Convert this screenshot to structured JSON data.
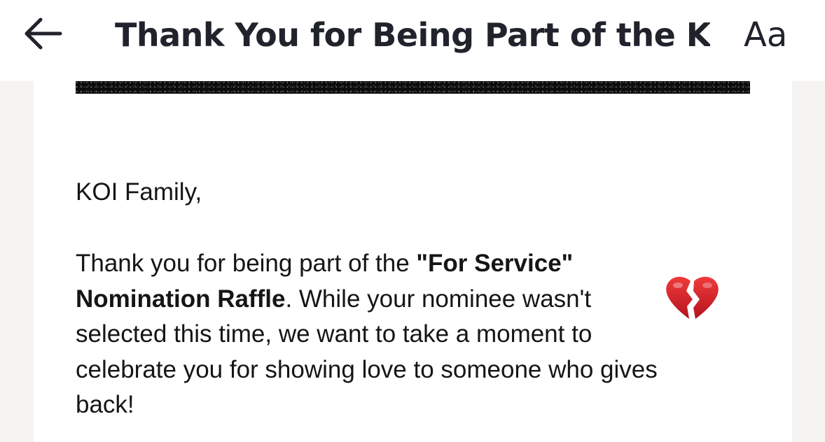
{
  "header": {
    "back_icon": "arrow-left-icon",
    "title": "Thank You for Being Part of the K...",
    "font_size_label": "Aa"
  },
  "email": {
    "banner_image": "dark-textured-banner",
    "greeting": "KOI Family,",
    "body": {
      "line1_text": "Thank you for being part of the ",
      "line1_bold": "\"For Service\"",
      "line2_bold": "Nomination Raffle",
      "line2_text": ". While your nominee wasn't",
      "emoji": "broken-heart-icon",
      "line3": "selected this time, we want to take a moment to",
      "line4": "celebrate you for showing love to someone who gives",
      "line5": "back!"
    }
  },
  "colors": {
    "header_bg": "#ffffff",
    "page_bg": "#f5f4f3",
    "text": "#151515",
    "heart": "#d81b2a"
  }
}
